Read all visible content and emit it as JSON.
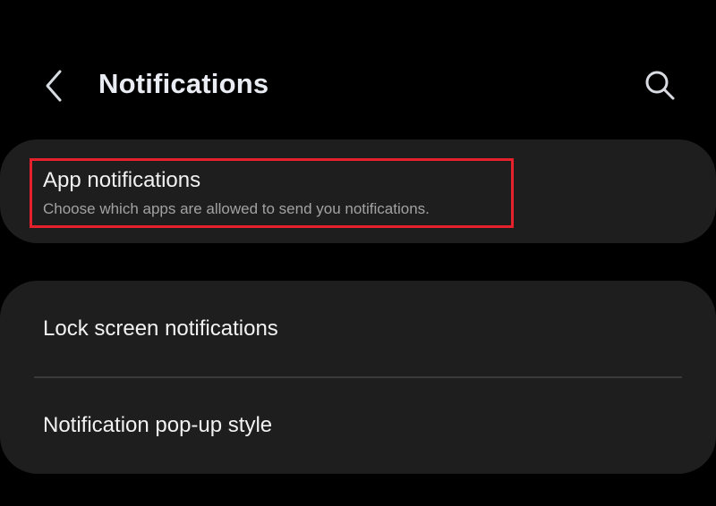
{
  "header": {
    "title": "Notifications",
    "back_icon": "chevron-left-icon",
    "search_icon": "search-icon"
  },
  "app_notifications": {
    "title": "App notifications",
    "subtitle": "Choose which apps are allowed to send you notifications."
  },
  "settings_list": {
    "items": [
      {
        "label": "Lock screen notifications"
      },
      {
        "label": "Notification pop-up style"
      }
    ]
  },
  "colors": {
    "background": "#000000",
    "card": "#1e1e1e",
    "highlight_border": "#e5222c",
    "subtitle_text": "#a2a2a2"
  }
}
